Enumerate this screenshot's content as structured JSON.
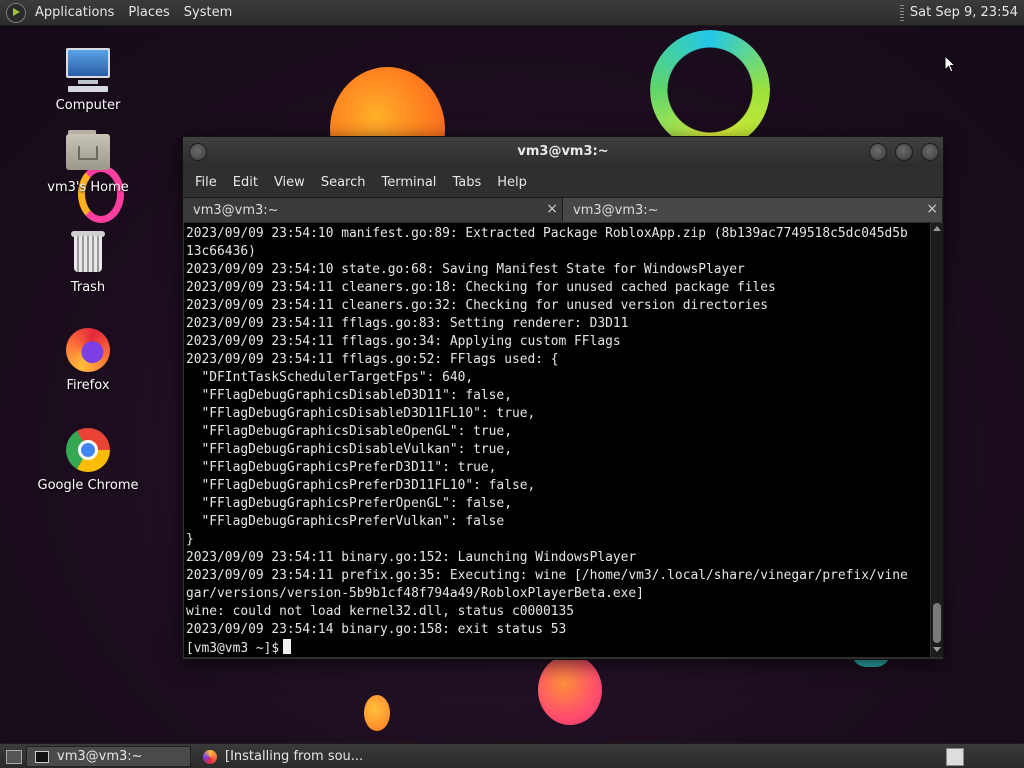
{
  "top_panel": {
    "menus": [
      "Applications",
      "Places",
      "System"
    ],
    "clock": "Sat Sep  9, 23:54"
  },
  "desktop_icons": [
    {
      "label": "Computer",
      "icon": "computer-icon"
    },
    {
      "label": "vm3's Home",
      "icon": "home-folder-icon"
    },
    {
      "label": "Trash",
      "icon": "trash-icon"
    },
    {
      "label": "Firefox",
      "icon": "firefox-icon"
    },
    {
      "label": "Google Chrome",
      "icon": "chrome-icon"
    }
  ],
  "terminal": {
    "title": "vm3@vm3:~",
    "menu": [
      "File",
      "Edit",
      "View",
      "Search",
      "Terminal",
      "Tabs",
      "Help"
    ],
    "tabs": [
      {
        "label": "vm3@vm3:~",
        "close": "×"
      },
      {
        "label": "vm3@vm3:~",
        "close": "×"
      }
    ],
    "lines": [
      "2023/09/09 23:54:10 manifest.go:89: Extracted Package RobloxApp.zip (8b139ac7749518c5dc045d5b",
      "13c66436)",
      "2023/09/09 23:54:10 state.go:68: Saving Manifest State for WindowsPlayer",
      "2023/09/09 23:54:11 cleaners.go:18: Checking for unused cached package files",
      "2023/09/09 23:54:11 cleaners.go:32: Checking for unused version directories",
      "2023/09/09 23:54:11 fflags.go:83: Setting renderer: D3D11",
      "2023/09/09 23:54:11 fflags.go:34: Applying custom FFlags",
      "2023/09/09 23:54:11 fflags.go:52: FFlags used: {",
      "  \"DFIntTaskSchedulerTargetFps\": 640,",
      "  \"FFlagDebugGraphicsDisableD3D11\": false,",
      "  \"FFlagDebugGraphicsDisableD3D11FL10\": true,",
      "  \"FFlagDebugGraphicsDisableOpenGL\": true,",
      "  \"FFlagDebugGraphicsDisableVulkan\": true,",
      "  \"FFlagDebugGraphicsPreferD3D11\": true,",
      "  \"FFlagDebugGraphicsPreferD3D11FL10\": false,",
      "  \"FFlagDebugGraphicsPreferOpenGL\": false,",
      "  \"FFlagDebugGraphicsPreferVulkan\": false",
      "}",
      "2023/09/09 23:54:11 binary.go:152: Launching WindowsPlayer",
      "2023/09/09 23:54:11 prefix.go:35: Executing: wine [/home/vm3/.local/share/vinegar/prefix/vine",
      "gar/versions/version-5b9b1cf48f794a49/RobloxPlayerBeta.exe]",
      "wine: could not load kernel32.dll, status c0000135",
      "2023/09/09 23:54:14 binary.go:158: exit status 53"
    ],
    "prompt": "[vm3@vm3 ~]$"
  },
  "taskbar": {
    "tasks": [
      {
        "label": "vm3@vm3:~",
        "icon": "terminal-icon",
        "active": true
      },
      {
        "label": "[Installing from sou...",
        "icon": "firefox-icon",
        "active": false
      }
    ]
  }
}
